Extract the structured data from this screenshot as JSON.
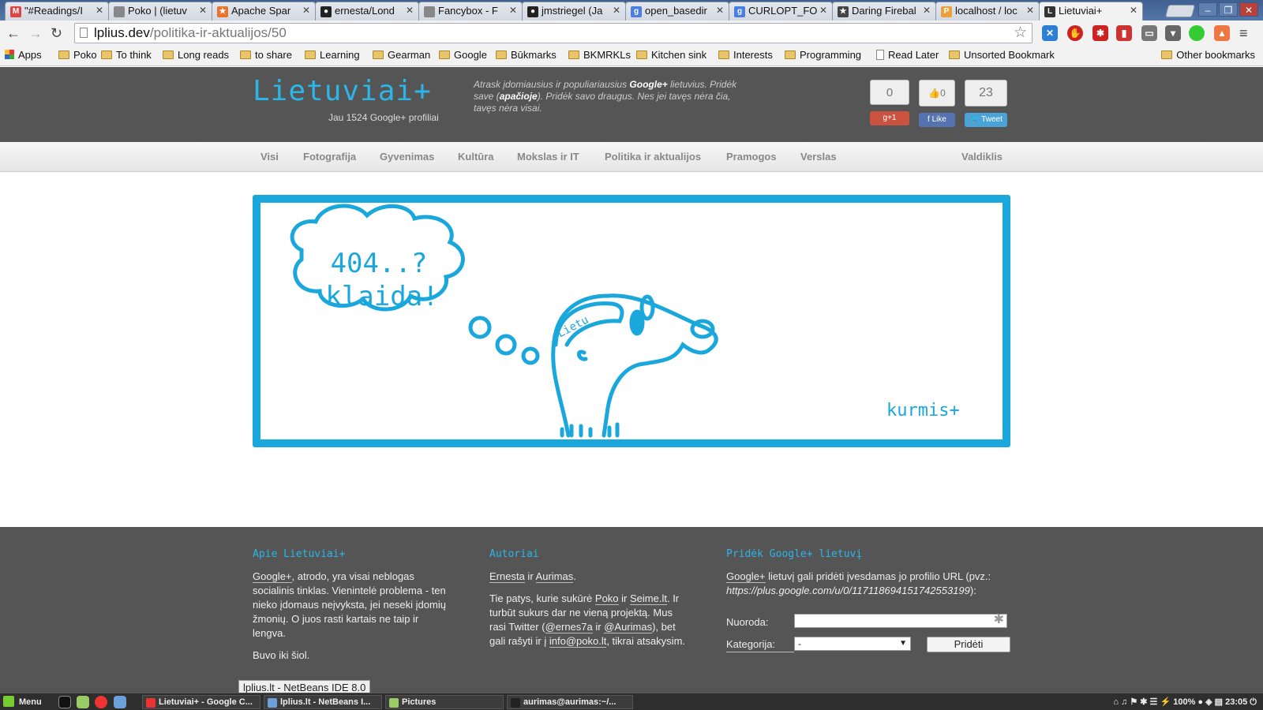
{
  "browser": {
    "tabs": [
      {
        "label": "\"#Readings/I",
        "fav_color": "#d44",
        "fav_glyph": "M"
      },
      {
        "label": "Poko | (lietuv",
        "fav_color": "#888",
        "fav_glyph": ""
      },
      {
        "label": "Apache Spar",
        "fav_color": "#e8732a",
        "fav_glyph": "★"
      },
      {
        "label": "ernesta/Lond",
        "fav_color": "#222",
        "fav_glyph": "●"
      },
      {
        "label": "Fancybox - F",
        "fav_color": "#888",
        "fav_glyph": ""
      },
      {
        "label": "jmstriegel (Ja",
        "fav_color": "#222",
        "fav_glyph": "●"
      },
      {
        "label": "open_basedir",
        "fav_color": "#4a7fe0",
        "fav_glyph": "g"
      },
      {
        "label": "CURLOPT_FO",
        "fav_color": "#4a7fe0",
        "fav_glyph": "g"
      },
      {
        "label": "Daring Firebal",
        "fav_color": "#444",
        "fav_glyph": "★"
      },
      {
        "label": "localhost / loc",
        "fav_color": "#e9a23b",
        "fav_glyph": "P"
      },
      {
        "label": "Lietuviai+",
        "fav_color": "#333",
        "fav_glyph": "L"
      }
    ],
    "url_host": "lplius.dev",
    "url_path": "/politika-ir-aktualijos/50",
    "bookmarks": [
      {
        "label": "Apps",
        "kind": "grid"
      },
      {
        "label": "Poko",
        "kind": "folder"
      },
      {
        "label": "To think",
        "kind": "folder"
      },
      {
        "label": "Long reads",
        "kind": "folder"
      },
      {
        "label": "to share",
        "kind": "folder"
      },
      {
        "label": "Learning",
        "kind": "folder"
      },
      {
        "label": "Gearman",
        "kind": "folder"
      },
      {
        "label": "Google",
        "kind": "folder"
      },
      {
        "label": "Būkmarks",
        "kind": "folder"
      },
      {
        "label": "BKMRKLs",
        "kind": "folder"
      },
      {
        "label": "Kitchen sink",
        "kind": "folder"
      },
      {
        "label": "Interests",
        "kind": "folder"
      },
      {
        "label": "Programming",
        "kind": "folder"
      },
      {
        "label": "Read Later",
        "kind": "doc"
      },
      {
        "label": "Unsorted Bookmark",
        "kind": "folder"
      }
    ],
    "other_bookmarks": "Other bookmarks"
  },
  "site": {
    "logo": "Lietuviai+",
    "logo_sub": "Jau 1524 Google+ profiliai",
    "tagline_1": "Atrask įdomiausius ir populiariausius ",
    "tagline_bold_1": "Google+",
    "tagline_2": " lietuvius. Pridėk save (",
    "tagline_bold_2": "apačioje",
    "tagline_3": "). Pridėk savo draugus. Nes jei tavęs nėra čia, tavęs nėra visai.",
    "share": [
      {
        "count": "0",
        "label": "g+1",
        "color": "#c9533f"
      },
      {
        "count": "👍0",
        "label": "f Like",
        "color": "#5573b0"
      },
      {
        "count": "23",
        "label": "🐦 Tweet",
        "color": "#4aa3d6"
      }
    ],
    "nav": [
      "Visi",
      "Fotografija",
      "Gyvenimas",
      "Kultūra",
      "Mokslas ir IT",
      "Politika ir aktualijos",
      "Pramogos",
      "Verslas"
    ],
    "nav_right": "Valdiklis",
    "accent": "#1aa7dc"
  },
  "error": {
    "line1": "404..?",
    "line2": "klaida!",
    "cap_text": "Lietu",
    "brand": "kurmis+"
  },
  "footer": {
    "about_title": "Apie Lietuviai+",
    "about_link": "Google+",
    "about_text": ", atrodo, yra visai neblogas socialinis tinklas. Vienintelė problema - ten nieko įdomaus neįvyksta, jei neseki įdomių žmonių. O juos rasti kartais ne taip ir lengva.",
    "about_text2": "Buvo iki šiol.",
    "authors_title": "Autoriai",
    "author1": "Ernesta",
    "authors_and": " ir ",
    "author2": "Aurimas",
    "authors_end": ".",
    "authors_p2a": "Tie patys, kurie sukūrė ",
    "link_poko": "Poko",
    "authors_p2b": " ir ",
    "link_seime": "Seime.lt",
    "authors_p2c": ". Ir turbūt sukurs dar ne vieną projektą. Mus rasi Twitter (",
    "tw1": "@ernes7a",
    "authors_p2d": " ir ",
    "tw2": "@Aurimas",
    "authors_p2e": "), bet gali rašyti ir į ",
    "email": "info@poko.lt",
    "authors_p2f": ", tikrai atsakysim.",
    "add_title": "Pridėk Google+ lietuvį",
    "add_link": "Google+",
    "add_text": " lietuvį gali pridėti įvesdamas jo profilio URL (pvz.: ",
    "add_example": "https://plus.google.com/u/0/117118694151742553199",
    "add_text_end": "):",
    "url_label": "Nuoroda:",
    "category_label": "Kategorija:",
    "category_value": "-",
    "submit": "Pridėti"
  },
  "status_tooltip": "lplius.lt - NetBeans IDE 8.0",
  "taskbar": {
    "menu": "Menu",
    "windows": [
      {
        "label": "Lietuviai+ - Google C...",
        "color": "#e33"
      },
      {
        "label": "lplius.lt - NetBeans I...",
        "color": "#6ba0d8"
      },
      {
        "label": "Pictures",
        "color": "#9c6"
      },
      {
        "label": "aurimas@aurimas:~/...",
        "color": "#222"
      }
    ],
    "battery": "100%",
    "clock": "23:05"
  }
}
